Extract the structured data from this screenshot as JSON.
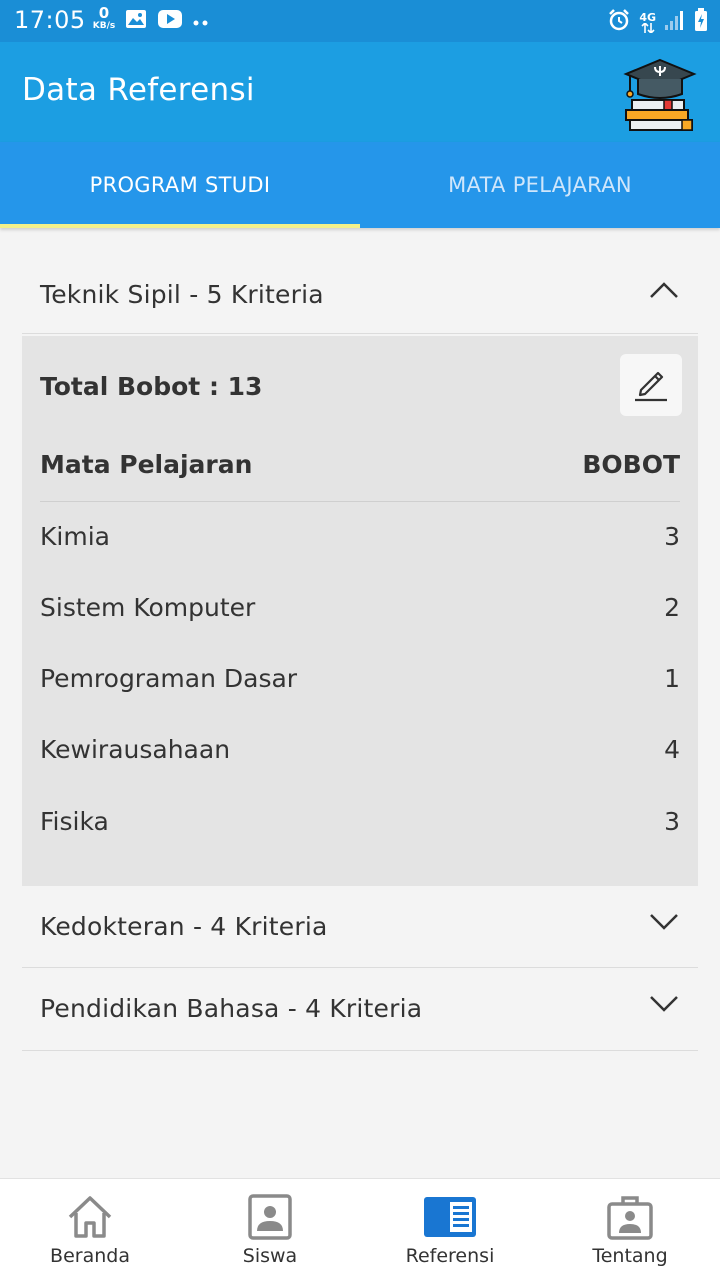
{
  "status_bar": {
    "time": "17:05",
    "net_speed_value": "0",
    "net_speed_unit": "KB/s",
    "network_label": "4G",
    "icons": [
      "image-icon",
      "youtube-icon",
      "alarm-icon",
      "signal-icon",
      "battery-icon"
    ]
  },
  "app_bar": {
    "title": "Data Referensi",
    "logo_icon": "graduation-cap-books-icon"
  },
  "tabs": [
    {
      "label": "PROGRAM STUDI",
      "active": true
    },
    {
      "label": "MATA PELAJARAN",
      "active": false
    }
  ],
  "groups": [
    {
      "label": "Teknik Sipil  - 5 Kriteria",
      "expanded": true,
      "total_label": "Total Bobot : 13",
      "col_subject": "Mata Pelajaran",
      "col_weight": "BOBOT",
      "rows": [
        {
          "subject": "Kimia",
          "weight": "3"
        },
        {
          "subject": "Sistem Komputer",
          "weight": "2"
        },
        {
          "subject": "Pemrograman Dasar",
          "weight": "1"
        },
        {
          "subject": "Kewirausahaan",
          "weight": "4"
        },
        {
          "subject": "Fisika",
          "weight": "3"
        }
      ]
    },
    {
      "label": "Kedokteran  - 4 Kriteria",
      "expanded": false
    },
    {
      "label": "Pendidikan Bahasa  - 4 Kriteria",
      "expanded": false
    }
  ],
  "bottom_nav": [
    {
      "label": "Beranda",
      "icon": "home-icon",
      "active": false
    },
    {
      "label": "Siswa",
      "icon": "person-icon",
      "active": false
    },
    {
      "label": "Referensi",
      "icon": "list-icon",
      "active": true
    },
    {
      "label": "Tentang",
      "icon": "briefcase-icon",
      "active": false
    }
  ],
  "colors": {
    "status_bar": "#1a8ed6",
    "app_bar": "#1c9ee2",
    "tab_bar": "#2596ea",
    "tab_indicator": "#f3f08a",
    "nav_active": "#1976d2",
    "nav_inactive": "#8a8a8a"
  }
}
